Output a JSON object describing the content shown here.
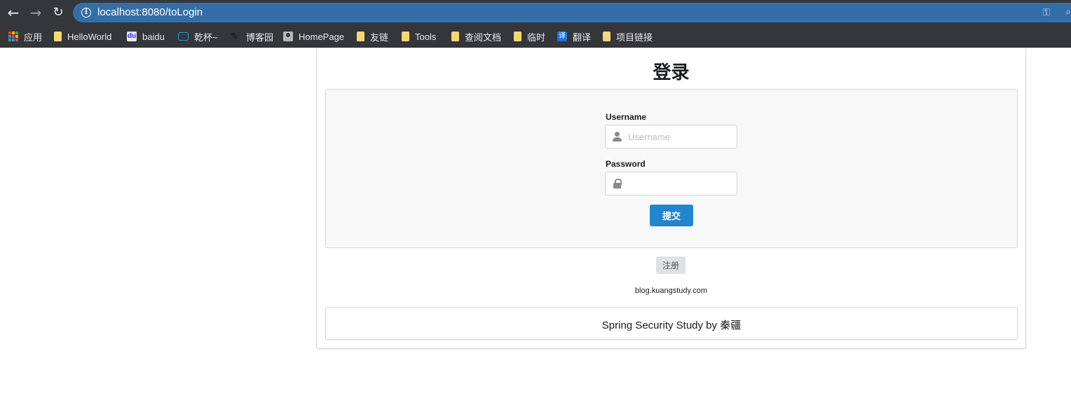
{
  "browser": {
    "url": "localhost:8080/toLogin",
    "bookmarks": [
      {
        "label": "应用",
        "icon": "apps-icon"
      },
      {
        "label": "HelloWorld",
        "icon": "folder-icon"
      },
      {
        "label": "baidu",
        "icon": "baidu-icon"
      },
      {
        "label": "乾杯~",
        "icon": "bilibili-icon"
      },
      {
        "label": "博客园",
        "icon": "cnblogs-icon"
      },
      {
        "label": "HomePage",
        "icon": "avatar-icon"
      },
      {
        "label": "友链",
        "icon": "folder-icon"
      },
      {
        "label": "Tools",
        "icon": "folder-icon"
      },
      {
        "label": "查阅文档",
        "icon": "folder-icon"
      },
      {
        "label": "临时",
        "icon": "folder-icon"
      },
      {
        "label": "翻译",
        "icon": "translate-icon"
      },
      {
        "label": "项目链接",
        "icon": "folder-icon"
      }
    ]
  },
  "page": {
    "title": "登录",
    "form": {
      "username_label": "Username",
      "username_placeholder": "Username",
      "username_value": "",
      "password_label": "Password",
      "password_value": "",
      "submit_label": "提交"
    },
    "register_label": "注册",
    "footer_link": "blog.kuangstudy.com",
    "credit": "Spring Security Study by 秦疆"
  },
  "colors": {
    "omnibox": "#346ea9",
    "primary_button": "#2185d0",
    "secondary_button": "#e0e1e2"
  }
}
